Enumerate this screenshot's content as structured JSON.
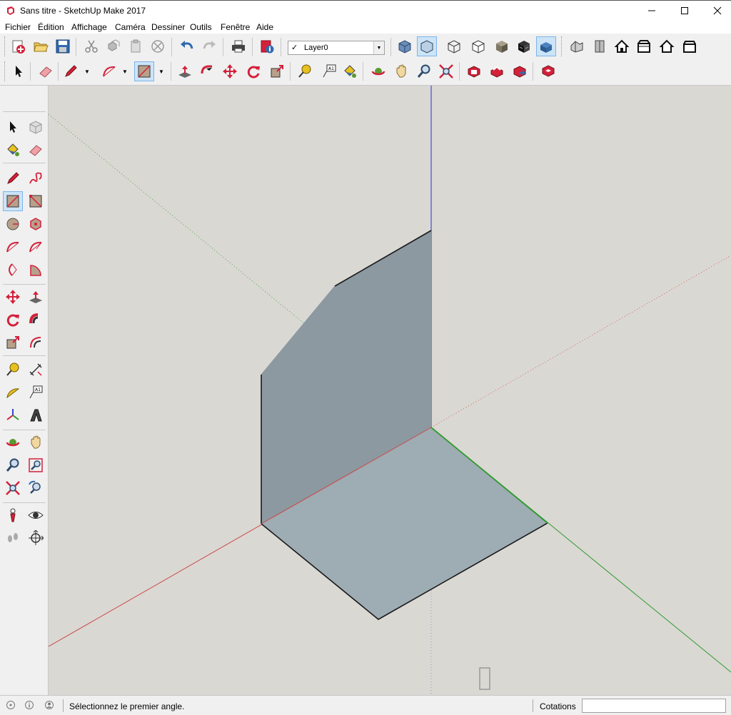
{
  "window": {
    "title": "Sans titre - SketchUp Make 2017"
  },
  "menu": [
    "Fichier",
    "Édition",
    "Affichage",
    "Caméra",
    "Dessiner",
    "Outils",
    "Fenêtre",
    "Aide"
  ],
  "layer": {
    "value": "Layer0",
    "check": "✓"
  },
  "status": {
    "message": "Sélectionnez le premier angle.",
    "measurements_label": "Cotations",
    "measurements_value": ""
  },
  "colors": {
    "viewport_bg": "#dad8d3",
    "face_vertical": "#8c99a1",
    "face_horizontal": "#9eacb3",
    "axis_red": "#c94a4a",
    "axis_green": "#2f9a2f",
    "axis_blue": "#4a4ad0",
    "edge": "#1a1a1a",
    "accent": "#d4213a"
  }
}
